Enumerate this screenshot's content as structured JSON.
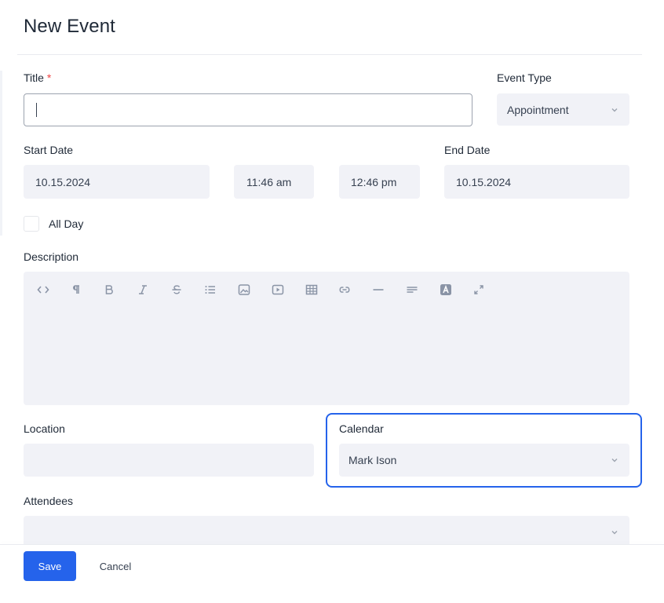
{
  "dialog": {
    "title": "New Event"
  },
  "title_field": {
    "label": "Title",
    "required_mark": "*",
    "value": ""
  },
  "event_type": {
    "label": "Event Type",
    "value": "Appointment"
  },
  "start": {
    "label": "Start Date",
    "date": "10.15.2024",
    "time": "11:46 am"
  },
  "end": {
    "label": "End Date",
    "time": "12:46 pm",
    "date": "10.15.2024"
  },
  "all_day": {
    "label": "All Day",
    "checked": false
  },
  "description": {
    "label": "Description",
    "toolbar": [
      "code-view-icon",
      "paragraph-icon",
      "bold-icon",
      "italic-icon",
      "strikethrough-icon",
      "list-icon",
      "image-icon",
      "video-icon",
      "table-icon",
      "link-icon",
      "horizontal-rule-icon",
      "align-icon",
      "text-color-icon",
      "fullscreen-icon"
    ]
  },
  "location": {
    "label": "Location",
    "value": ""
  },
  "calendar": {
    "label": "Calendar",
    "value": "Mark Ison"
  },
  "attendees": {
    "label": "Attendees",
    "value": ""
  },
  "actions": {
    "save": "Save",
    "cancel": "Cancel"
  },
  "colors": {
    "accent": "#2563eb",
    "field_bg": "#f1f2f7",
    "required": "#ef4444"
  }
}
